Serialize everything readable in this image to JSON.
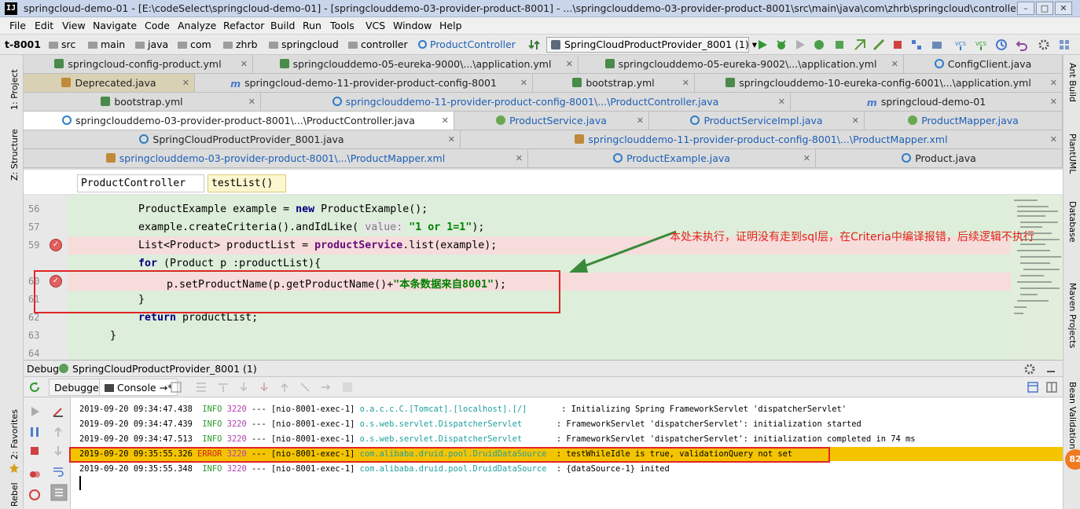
{
  "window": {
    "title": "springcloud-demo-01 - [E:\\codeSelect\\springcloud-demo-01] - [springclouddemo-03-provider-product-8001] - ...\\springclouddemo-03-provider-product-8001\\src\\main\\java\\com\\zhrb\\springcloud\\controller\\Pr...",
    "app_icon": "IJ"
  },
  "menu": [
    "File",
    "Edit",
    "View",
    "Navigate",
    "Code",
    "Analyze",
    "Refactor",
    "Build",
    "Run",
    "Tools",
    "VCS",
    "Window",
    "Help"
  ],
  "nav": {
    "project": "t-8001",
    "crumbs": [
      "src",
      "main",
      "java",
      "com",
      "zhrb",
      "springcloud",
      "controller"
    ],
    "class": "ProductController",
    "run_config": "SpringCloudProductProvider_8001 (1)"
  },
  "tabs": [
    [
      "springcloud-config-product.yml",
      "springclouddemo-05-eureka-9000\\...\\application.yml",
      "springclouddemo-05-eureka-9002\\...\\application.yml",
      "ConfigClient.java"
    ],
    [
      "Deprecated.java",
      "springcloud-demo-11-provider-product-config-8001",
      "bootstrap.yml",
      "springclouddemo-10-eureka-config-6001\\...\\application.yml"
    ],
    [
      "bootstrap.yml",
      "springclouddemo-11-provider-product-config-8001\\...\\ProductController.java",
      "springcloud-demo-01"
    ],
    [
      "springclouddemo-03-provider-product-8001\\...\\ProductController.java",
      "ProductService.java",
      "ProductServiceImpl.java",
      "ProductMapper.java"
    ],
    [
      "SpringCloudProductProvider_8001.java",
      "springclouddemo-11-provider-product-config-8001\\...\\ProductMapper.xml"
    ],
    [
      "springclouddemo-03-provider-product-8001\\...\\ProductMapper.xml",
      "ProductExample.java",
      "Product.java"
    ]
  ],
  "breadcrumb": [
    "ProductController",
    "testList()"
  ],
  "editor": {
    "line_numbers": [
      "56",
      "57",
      "59",
      "60",
      "61",
      "62",
      "63",
      "64"
    ],
    "lines": {
      "l56": {
        "pre": "ProductExample example = ",
        "kw": "new",
        "post": " ProductExample();"
      },
      "l57": {
        "pre": "example.createCriteria().andIdLike( ",
        "hint": "value:",
        "str": "\"1 or 1=1\"",
        "post": ");"
      },
      "l59": {
        "pre": "List<Product> productList = ",
        "field": "productService",
        "post": ".list(example);"
      },
      "l60": {
        "kw": "for",
        "post": " (Product p :productList){"
      },
      "l61": {
        "pre": "p.setProductName(p.getProductName()+",
        "str": "\"本条数据来自8001\"",
        "post": ");"
      },
      "l62": {
        "text": "}"
      },
      "l63": {
        "kw": "return",
        "post": " productList;"
      },
      "l64": {
        "text": "}"
      }
    }
  },
  "annotation": "本处未执行，证明没有走到sql层，在Criteria中编译报错，后续逻辑不执行",
  "debug": {
    "label": "Debug",
    "session": "SpringCloudProductProvider_8001 (1)",
    "tabs": [
      "Debugger",
      "Console"
    ],
    "log": [
      {
        "ts": "2019-09-20 09:34:47.438",
        "level": "INFO",
        "pid": "3220",
        "thread": "--- [nio-8001-exec-1]",
        "logger": "o.a.c.c.C.[Tomcat].[localhost].[/]",
        "msg": ": Initializing Spring FrameworkServlet 'dispatcherServlet'"
      },
      {
        "ts": "2019-09-20 09:34:47.439",
        "level": "INFO",
        "pid": "3220",
        "thread": "--- [nio-8001-exec-1]",
        "logger": "o.s.web.servlet.DispatcherServlet",
        "msg": ": FrameworkServlet 'dispatcherServlet': initialization started"
      },
      {
        "ts": "2019-09-20 09:34:47.513",
        "level": "INFO",
        "pid": "3220",
        "thread": "--- [nio-8001-exec-1]",
        "logger": "o.s.web.servlet.DispatcherServlet",
        "msg": ": FrameworkServlet 'dispatcherServlet': initialization completed in 74 ms"
      },
      {
        "ts": "2019-09-20 09:35:55.326",
        "level": "ERROR",
        "pid": "3220",
        "thread": "--- [nio-8001-exec-1]",
        "logger": "com.alibaba.druid.pool.DruidDataSource",
        "msg": ": testWhileIdle is true, validationQuery not set"
      },
      {
        "ts": "2019-09-20 09:35:55.348",
        "level": "INFO",
        "pid": "3220",
        "thread": "--- [nio-8001-exec-1]",
        "logger": "com.alibaba.druid.pool.DruidDataSource",
        "msg": ": {dataSource-1} inited"
      }
    ]
  },
  "side_left": [
    "1: Project",
    "Z: Structure",
    "2: Favorites",
    "Rebel"
  ],
  "side_right": [
    "Ant Build",
    "PlantUML",
    "Database",
    "Maven Projects",
    "Bean Validation"
  ],
  "badge": "82",
  "colors": {
    "editor_bg": "#ddeeda",
    "breakpoint_line": "#f7dcdc",
    "error_row": "#f5c400",
    "annotation_red": "#e2231a",
    "arrow_green": "#3a8a3a"
  }
}
